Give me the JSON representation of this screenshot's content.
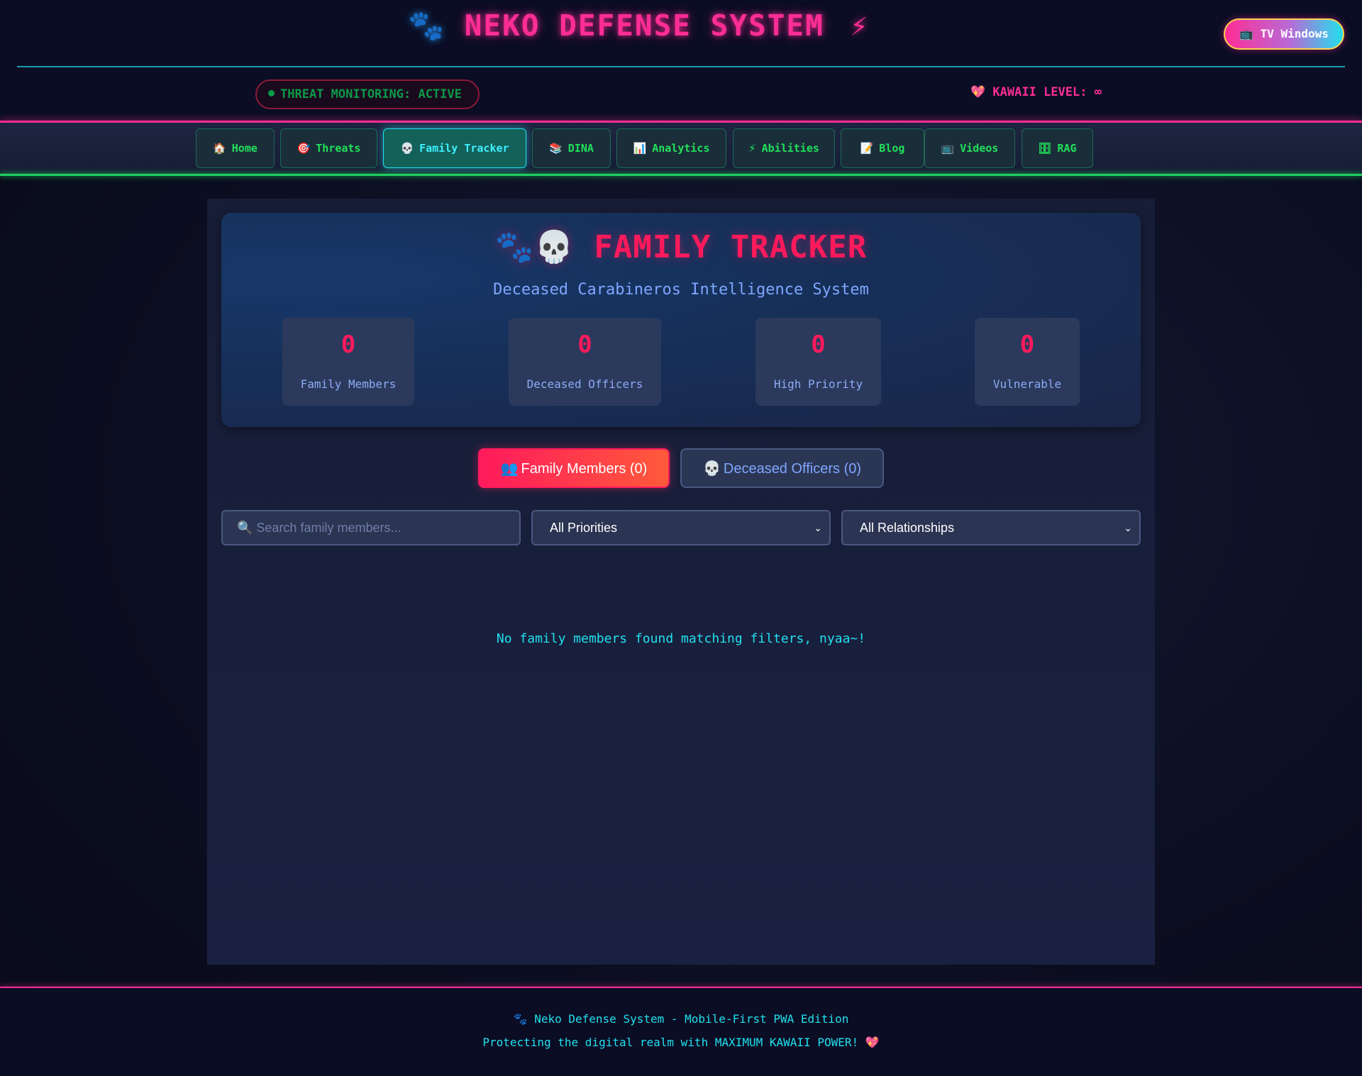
{
  "header": {
    "title_icon": "🐾",
    "title": "NEKO DEFENSE SYSTEM",
    "title_suffix_icon": "⚡",
    "tv_button": {
      "icon": "📺",
      "label": "TV Windows"
    },
    "threat_status": "THREAT MONITORING: ACTIVE",
    "kawaii": {
      "icon": "💖",
      "label": "KAWAII LEVEL: ∞"
    }
  },
  "nav": {
    "items": [
      {
        "icon": "🏠",
        "label": "Home"
      },
      {
        "icon": "🎯",
        "label": "Threats"
      },
      {
        "icon": "💀",
        "label": "Family Tracker",
        "active": true
      },
      {
        "icon": "📚",
        "label": "DINA"
      },
      {
        "icon": "📊",
        "label": "Analytics"
      },
      {
        "icon": "⚡",
        "label": "Abilities"
      },
      {
        "icon": "📝",
        "label": "Blog"
      },
      {
        "icon": "📺",
        "label": "Videos"
      },
      {
        "icon": "🗄",
        "label": "RAG"
      }
    ]
  },
  "hero": {
    "icons": "🐾💀",
    "title": "FAMILY TRACKER",
    "subtitle": "Deceased Carabineros Intelligence System",
    "stats": [
      {
        "value": "0",
        "label": "Family Members"
      },
      {
        "value": "0",
        "label": "Deceased Officers"
      },
      {
        "value": "0",
        "label": "High Priority"
      },
      {
        "value": "0",
        "label": "Vulnerable"
      }
    ]
  },
  "tabs": [
    {
      "icon": "👥",
      "label": "Family Members (0)",
      "active": true
    },
    {
      "icon": "💀",
      "label": "Deceased Officers (0)",
      "active": false
    }
  ],
  "filters": {
    "search_placeholder": "🔍 Search family members...",
    "priority_selected": "All Priorities",
    "relationship_selected": "All Relationships"
  },
  "empty_message": "No family members found matching filters, nyaa~!",
  "footer": {
    "line1_icon": "🐾",
    "line1": "Neko Defense System - Mobile-First PWA Edition",
    "line2": "Protecting the digital realm with MAXIMUM KAWAII POWER!",
    "line2_icon": "💖"
  },
  "colors": {
    "accent_pink": "#ff2d95",
    "accent_red": "#ff1a5c",
    "accent_cyan": "#22e0ee",
    "accent_green": "#22e05a",
    "background": "#0a0d24"
  }
}
